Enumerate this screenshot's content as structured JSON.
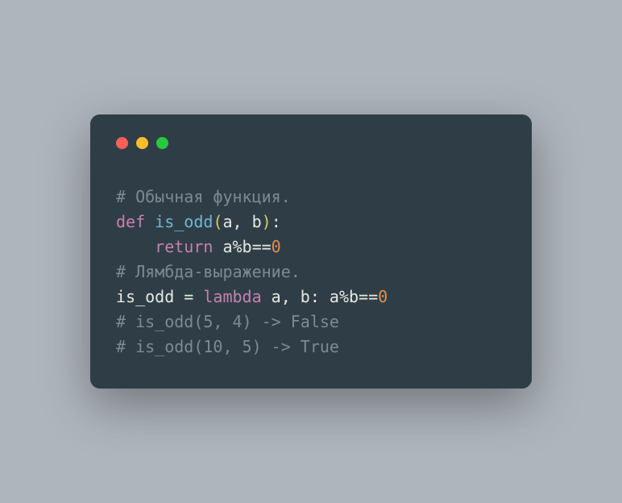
{
  "code": {
    "line1_comment": "# Обычная функция.",
    "line2_def": "def",
    "line2_name": " is_odd",
    "line2_parenL": "(",
    "line2_params": "a, b",
    "line2_parenR": ")",
    "line2_colon": ":",
    "line3_indent": "    ",
    "line3_return": "return",
    "line3_expr": " a%b==",
    "line3_zero": "0",
    "line4_comment": "# Лямбда-выражение.",
    "line5_assign": "is_odd = ",
    "line5_lambda": "lambda",
    "line5_rest": " a, b: a%b==",
    "line5_zero": "0",
    "line6_comment": "# is_odd(5, 4) -> False",
    "line7_comment": "# is_odd(10, 5) -> True"
  }
}
